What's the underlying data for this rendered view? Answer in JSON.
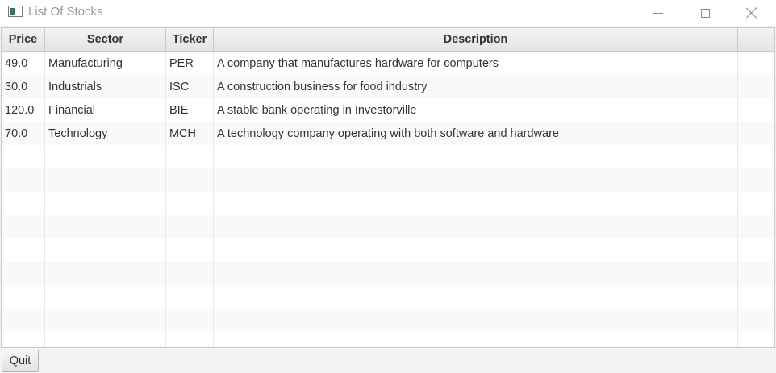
{
  "window": {
    "title": "List Of Stocks",
    "icon": "app-window-icon",
    "controls": [
      "minimize-icon",
      "maximize-icon",
      "close-icon"
    ]
  },
  "table": {
    "headers": [
      "Price",
      "Sector",
      "Ticker",
      "Description"
    ],
    "rows": [
      {
        "price": "49.0",
        "sector": "Manufacturing",
        "ticker": "PER",
        "description": "A company that manufactures hardware for computers"
      },
      {
        "price": "30.0",
        "sector": "Industrials",
        "ticker": "ISC",
        "description": "A construction business for food industry"
      },
      {
        "price": "120.0",
        "sector": "Financial",
        "ticker": "BIE",
        "description": "A stable bank operating in Investorville"
      },
      {
        "price": "70.0",
        "sector": "Technology",
        "ticker": "MCH",
        "description": "A technology company operating with both software and hardware"
      }
    ]
  },
  "buttons": {
    "quit": "Quit"
  }
}
